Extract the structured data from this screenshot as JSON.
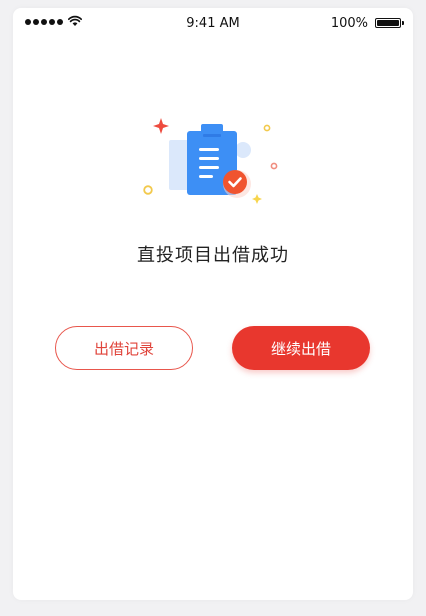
{
  "status_bar": {
    "time": "9:41 AM",
    "battery": "100%"
  },
  "icons": {
    "signal": "signal-dots-icon",
    "wifi": "wifi-icon",
    "battery": "battery-icon",
    "illustration": "clipboard-check-icon"
  },
  "result": {
    "title": "直投项目出借成功"
  },
  "actions": {
    "record_label": "出借记录",
    "continue_label": "继续出借"
  },
  "colors": {
    "primary": "#e8372e",
    "illustration_blue": "#3d8ff5",
    "check_badge": "#f0542f"
  }
}
